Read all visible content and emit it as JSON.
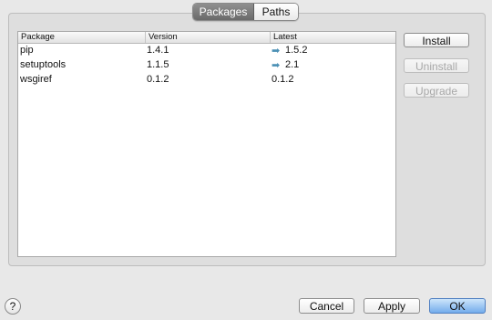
{
  "tabs": {
    "packages": "Packages",
    "paths": "Paths"
  },
  "table": {
    "headers": [
      "Package",
      "Version",
      "Latest"
    ],
    "rows": [
      {
        "package": "pip",
        "version": "1.4.1",
        "latest": "1.5.2",
        "update_icon": "arrow-right-icon"
      },
      {
        "package": "setuptools",
        "version": "1.1.5",
        "latest": "2.1",
        "update_icon": "arrow-right-icon"
      },
      {
        "package": "wsgiref",
        "version": "0.1.2",
        "latest": "0.1.2"
      }
    ]
  },
  "side_buttons": {
    "install": "Install",
    "uninstall": "Uninstall",
    "upgrade": "Upgrade"
  },
  "footer": {
    "help": "?",
    "cancel": "Cancel",
    "apply": "Apply",
    "ok": "OK"
  },
  "colors": {
    "accent": "#73acec",
    "update_arrow": "#4a8fb4"
  }
}
